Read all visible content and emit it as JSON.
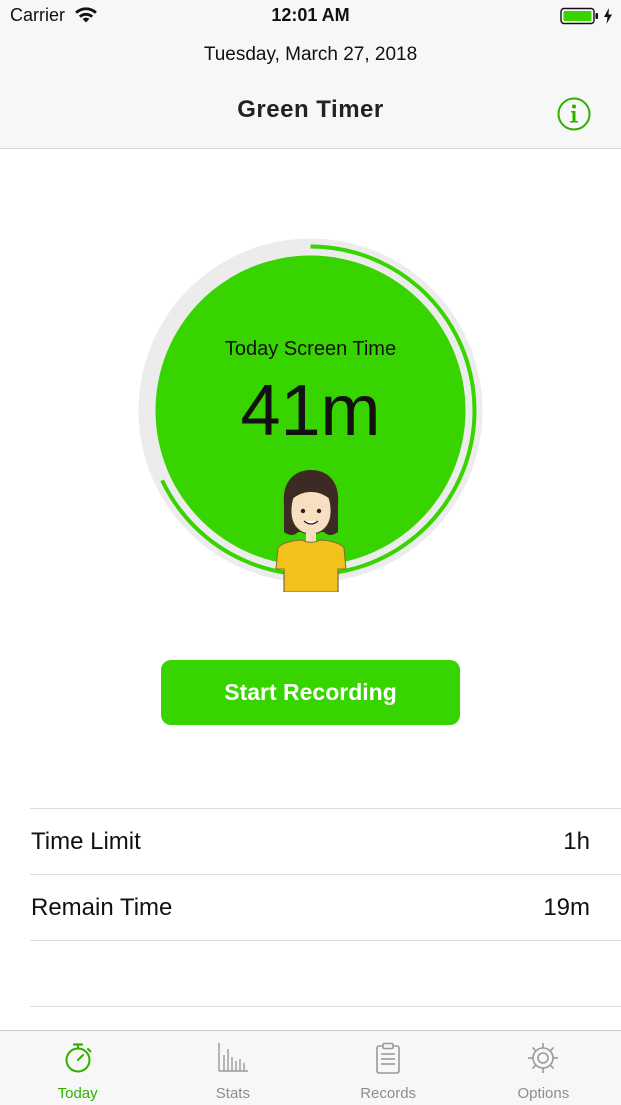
{
  "status_bar": {
    "carrier": "Carrier",
    "time": "12:01 AM"
  },
  "header": {
    "date": "Tuesday, March 27, 2018",
    "title": "Green  Timer",
    "info_icon": "info-icon"
  },
  "timer_card": {
    "caption": "Today Screen Time",
    "value": "41m",
    "progress_fraction": 0.68,
    "accent_color": "#38d400",
    "track_color": "#ececec"
  },
  "actions": {
    "start_label": "Start Recording"
  },
  "stats_rows": [
    {
      "label": "Time Limit",
      "value": "1h"
    },
    {
      "label": "Remain Time",
      "value": "19m"
    }
  ],
  "tabs": [
    {
      "label": "Today",
      "icon": "stopwatch-icon",
      "active": true
    },
    {
      "label": "Stats",
      "icon": "bar-chart-icon",
      "active": false
    },
    {
      "label": "Records",
      "icon": "clipboard-icon",
      "active": false
    },
    {
      "label": "Options",
      "icon": "gear-icon",
      "active": false
    }
  ],
  "colors": {
    "brand_green": "#38d400",
    "active_tab": "#2fb000",
    "inactive_tab": "#8e8e8e"
  }
}
